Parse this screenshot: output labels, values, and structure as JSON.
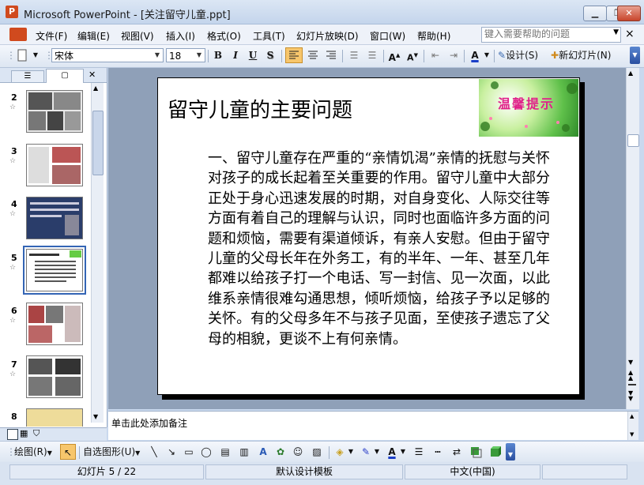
{
  "window": {
    "title": "Microsoft PowerPoint - [关注留守儿童.ppt]",
    "app_icon_glyph": "P",
    "minimize": "▁",
    "restore": "❐",
    "close": "✕"
  },
  "menu": {
    "items": [
      "文件(F)",
      "编辑(E)",
      "视图(V)",
      "插入(I)",
      "格式(O)",
      "工具(T)",
      "幻灯片放映(D)",
      "窗口(W)",
      "帮助(H)"
    ],
    "help_placeholder": "键入需要帮助的问题",
    "close_glyph": "×"
  },
  "toolbar": {
    "font_name": "宋体",
    "font_size": "18",
    "bold": "B",
    "italic": "I",
    "underline": "U",
    "shadow": "S",
    "design_label": "设计(S)",
    "new_slide_label": "新幻灯片(N)"
  },
  "panel": {
    "thumbnails": [
      {
        "number": "2"
      },
      {
        "number": "3"
      },
      {
        "number": "4"
      },
      {
        "number": "5"
      },
      {
        "number": "6"
      },
      {
        "number": "7"
      },
      {
        "number": "8"
      }
    ],
    "star": "☆",
    "close_glyph": "✕"
  },
  "slide": {
    "title": "留守儿童的主要问题",
    "banner_text": "温馨提示",
    "body": "一、留守儿童存在严重的“亲情饥渴”亲情的抚慰与关怀对孩子的成长起着至关重要的作用。留守儿童中大部分正处于身心迅速发展的时期，对自身变化、人际交往等方面有着自己的理解与认识，同时也面临许多方面的问题和烦恼，需要有渠道倾诉，有亲人安慰。但由于留守儿童的父母长年在外务工，有的半年、一年、甚至几年都难以给孩子打一个电话、写一封信、见一次面，以此维系亲情很难勾通思想，倾听烦恼，给孩子予以足够的关怀。有的父母多年不与孩子见面，至使孩子遗忘了父母的相貌，更谈不上有何亲情。"
  },
  "notes": {
    "placeholder": "单击此处添加备注"
  },
  "drawing": {
    "draw_label": "绘图(R)",
    "autoshape_label": "自选图形(U)"
  },
  "status": {
    "slide_indicator": "幻灯片 5 / 22",
    "template": "默认设计模板",
    "language": "中文(中国)"
  }
}
